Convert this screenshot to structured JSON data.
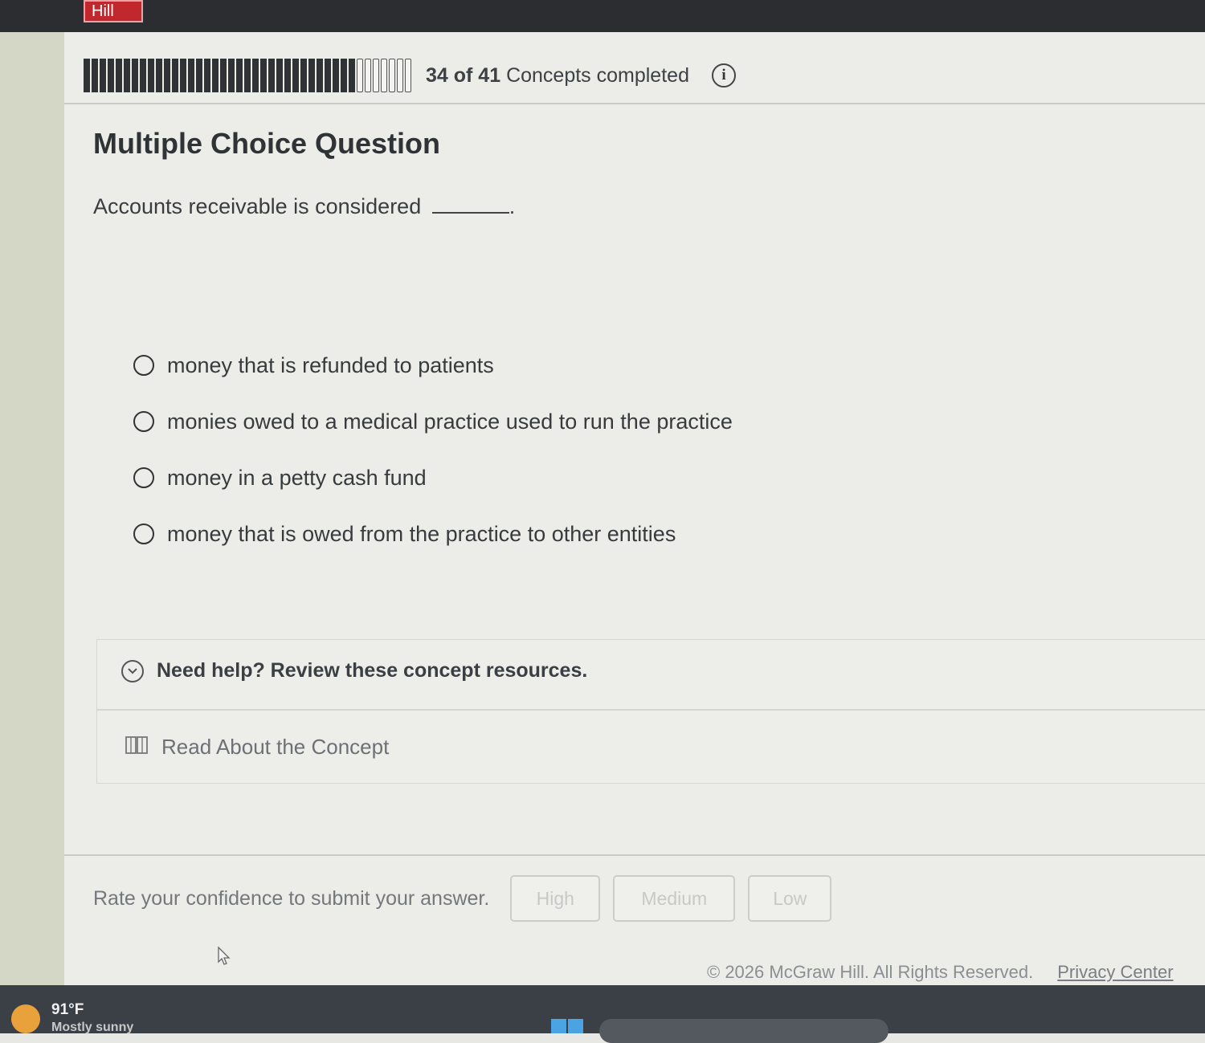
{
  "header": {
    "brand": "Hill"
  },
  "progress": {
    "completed": 34,
    "total": 41,
    "count_text": "34 of 41",
    "label": "Concepts completed",
    "info_icon": "info-icon"
  },
  "question": {
    "type_title": "Multiple Choice Question",
    "stem": "Accounts receivable is considered",
    "stem_end": ".",
    "options": [
      {
        "label": "money that is refunded to patients",
        "selected": false
      },
      {
        "label": "monies owed to a medical practice used to run the practice",
        "selected": false
      },
      {
        "label": "money in a petty cash fund",
        "selected": false
      },
      {
        "label": "money that is owed from the practice to other entities",
        "selected": false
      }
    ]
  },
  "help": {
    "title": "Need help? Review these concept resources.",
    "toggle_icon": "chevron-down-icon",
    "resource_icon": "book-icon",
    "read_label": "Read About the Concept"
  },
  "confidence": {
    "prompt": "Rate your confidence to submit your answer.",
    "high_label": "High",
    "medium_label": "Medium",
    "low_label": "Low"
  },
  "footer": {
    "copyright": "© 2026 McGraw Hill. All Rights Reserved.",
    "privacy_label": "Privacy Center"
  },
  "taskbar": {
    "temperature": "91°F",
    "weather": "Mostly sunny"
  }
}
